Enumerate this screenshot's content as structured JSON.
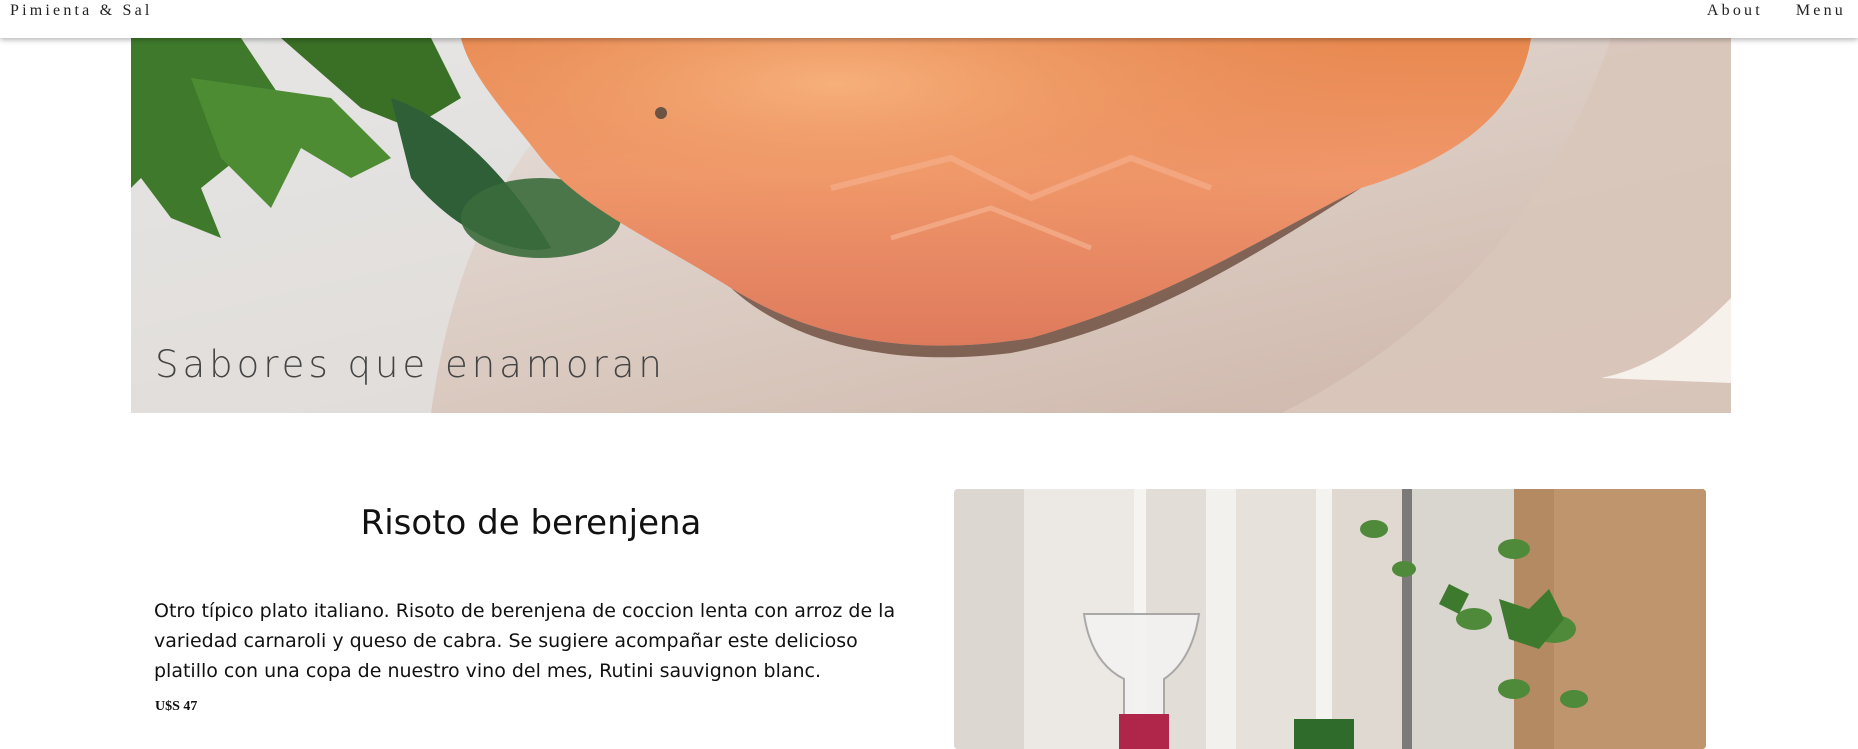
{
  "navbar": {
    "brand": "Pimienta & Sal",
    "links": [
      "About",
      "Menu"
    ]
  },
  "hero": {
    "title": "Sabores que enamoran",
    "image": "salmon-plate-photo"
  },
  "dish": {
    "title": "Risoto de berenjena",
    "description": "Otro típico plato italiano. Risoto de berenjena de coccion lenta con arroz de la variedad carnaroli y queso de cabra. Se sugiere acompañar este delicioso platillo con una copa de nuestro vino del mes, Rutini sauvignon blanc.",
    "price": "U$S 47",
    "image": "wine-glass-photo"
  }
}
